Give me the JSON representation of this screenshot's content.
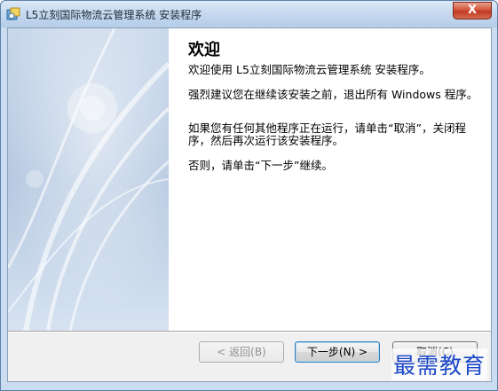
{
  "window": {
    "title": "L5立刻国际物流云管理系统 安装程序",
    "close_label": "X"
  },
  "content": {
    "heading": "欢迎",
    "paragraphs": [
      "欢迎使用 L5立刻国际物流云管理系统  安装程序。",
      "强烈建议您在继续该安装之前，退出所有 Windows 程序。",
      "如果您有任何其他程序正在运行，请单击“取消”，关闭程序，然后再次运行该安装程序。",
      "否则，请单击“下一步”继续。"
    ]
  },
  "buttons": {
    "back": "< 返回(B)",
    "next": "下一步(N) >",
    "cancel": "取消(C)"
  },
  "watermark": "最需教育",
  "colors": {
    "titlebar": "#c4d8ee",
    "side_panel": "#b9cbe3",
    "default_button_border": "#3c7fb1"
  }
}
